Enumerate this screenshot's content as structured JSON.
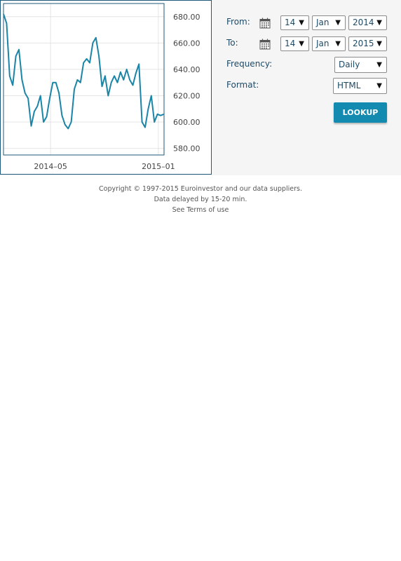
{
  "chart_data": {
    "type": "line",
    "x_tick_labels": [
      "2014–05",
      "2015–01"
    ],
    "y_tick_labels": [
      "680.00",
      "660.00",
      "640.00",
      "620.00",
      "600.00",
      "580.00"
    ],
    "ylim": [
      575,
      690
    ],
    "x_range": [
      "2014-01-14",
      "2015-01-14"
    ],
    "grid": true,
    "line_color": "#1a85a6",
    "series": [
      {
        "x": [
          "2014-01-14",
          "2014-01-21",
          "2014-01-28",
          "2014-02-04",
          "2014-02-11",
          "2014-02-18",
          "2014-02-25",
          "2014-03-04",
          "2014-03-11",
          "2014-03-18",
          "2014-03-25",
          "2014-04-01",
          "2014-04-08",
          "2014-04-15",
          "2014-04-22",
          "2014-04-29",
          "2014-05-06",
          "2014-05-13",
          "2014-05-20",
          "2014-05-27",
          "2014-06-03",
          "2014-06-10",
          "2014-06-17",
          "2014-06-24",
          "2014-07-01",
          "2014-07-08",
          "2014-07-15",
          "2014-07-22",
          "2014-07-29",
          "2014-08-05",
          "2014-08-12",
          "2014-08-19",
          "2014-08-26",
          "2014-09-02",
          "2014-09-09",
          "2014-09-16",
          "2014-09-23",
          "2014-09-30",
          "2014-10-07",
          "2014-10-14",
          "2014-10-21",
          "2014-10-28",
          "2014-11-04",
          "2014-11-11",
          "2014-11-18",
          "2014-11-25",
          "2014-12-02",
          "2014-12-09",
          "2014-12-16",
          "2014-12-23",
          "2014-12-30",
          "2015-01-06",
          "2015-01-14"
        ],
        "values": [
          682,
          675,
          635,
          628,
          650,
          655,
          632,
          622,
          618,
          597,
          608,
          612,
          620,
          600,
          604,
          618,
          630,
          630,
          622,
          605,
          598,
          595,
          600,
          625,
          632,
          630,
          645,
          648,
          645,
          660,
          664,
          650,
          627,
          635,
          620,
          630,
          635,
          630,
          638,
          632,
          640,
          632,
          628,
          637,
          644,
          600,
          596,
          610,
          620,
          600,
          606,
          605,
          606
        ]
      }
    ]
  },
  "controls": {
    "from_label": "From:",
    "to_label": "To:",
    "frequency_label": "Frequency:",
    "format_label": "Format:",
    "from_day": "14",
    "from_month": "Jan",
    "from_year": "2014",
    "to_day": "14",
    "to_month": "Jan",
    "to_year": "2015",
    "frequency_value": "Daily",
    "format_value": "HTML",
    "lookup_label": "LOOKUP",
    "calendar_icon": "calendar-icon",
    "accent_color": "#138bb0",
    "label_color": "#1d4a66"
  },
  "footer": {
    "line1": "Copyright © 1997-2015 Euroinvestor and our data suppliers.",
    "line2": "Data delayed by 15-20 min.",
    "line3": "See Terms of use"
  }
}
